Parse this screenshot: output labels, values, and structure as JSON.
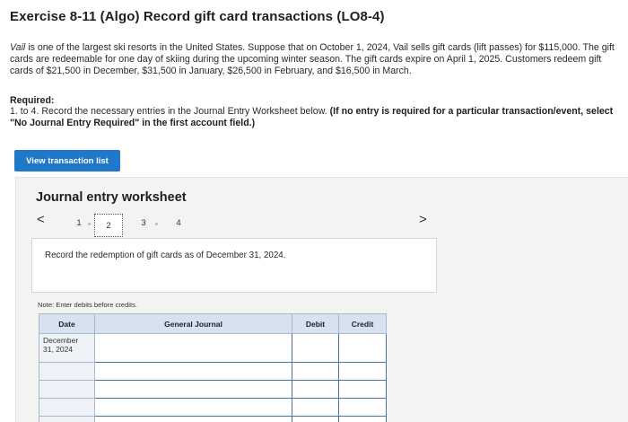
{
  "title": "Exercise 8-11 (Algo) Record gift card transactions (LO8-4)",
  "intro": {
    "company": "Vail",
    "text": " is one of the largest ski resorts in the United States. Suppose that on October 1, 2024, Vail sells gift cards (lift passes) for $115,000. The gift cards are redeemable for one day of skiing during the upcoming winter season. The gift cards expire on April 1, 2025. Customers redeem gift cards of $21,500 in December, $31,500 in January, $26,500 in February, and $16,500 in March."
  },
  "required": {
    "heading": "Required:",
    "lead": "1. to 4. Record the necessary entries in the Journal Entry Worksheet below. ",
    "bold": "(If no entry is required for a particular transaction/event, select \"No Journal Entry Required\" in the first account field.)"
  },
  "view_button_label": "View transaction list",
  "worksheet": {
    "title": "Journal entry worksheet",
    "prev_icon": "<",
    "next_icon": ">",
    "steps": [
      "1",
      "2",
      "3",
      "4"
    ],
    "active_step": "2",
    "instruction": "Record the redemption of gift cards as of December 31, 2024.",
    "note": "Note: Enter debits before credits.",
    "columns": {
      "date": "Date",
      "journal": "General Journal",
      "debit": "Debit",
      "credit": "Credit"
    },
    "first_date": "December\n31, 2024"
  }
}
